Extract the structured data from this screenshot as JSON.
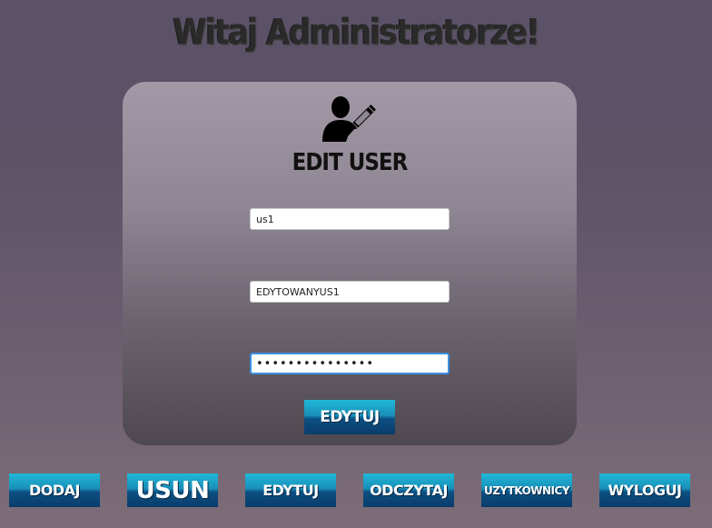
{
  "page": {
    "title": "Witaj Administratorze!"
  },
  "form": {
    "title": "EDIT USER",
    "icon": "user-edit-icon",
    "username_value": "us1",
    "new_username_value": "EDYTOWANYUS1",
    "password_value": "•••••••••••••••",
    "submit_label": "EDYTUJ"
  },
  "nav": {
    "items": [
      {
        "label": "DODAJ"
      },
      {
        "label": "USUN"
      },
      {
        "label": "EDYTUJ"
      },
      {
        "label": "ODCZYTAJ"
      },
      {
        "label": "UZYTKOWNICY"
      },
      {
        "label": "WYLOGUJ"
      }
    ]
  },
  "colors": {
    "button_top": "#1fb8d8",
    "button_bottom": "#0a3c6b",
    "focus_border": "#3b8fe0"
  }
}
